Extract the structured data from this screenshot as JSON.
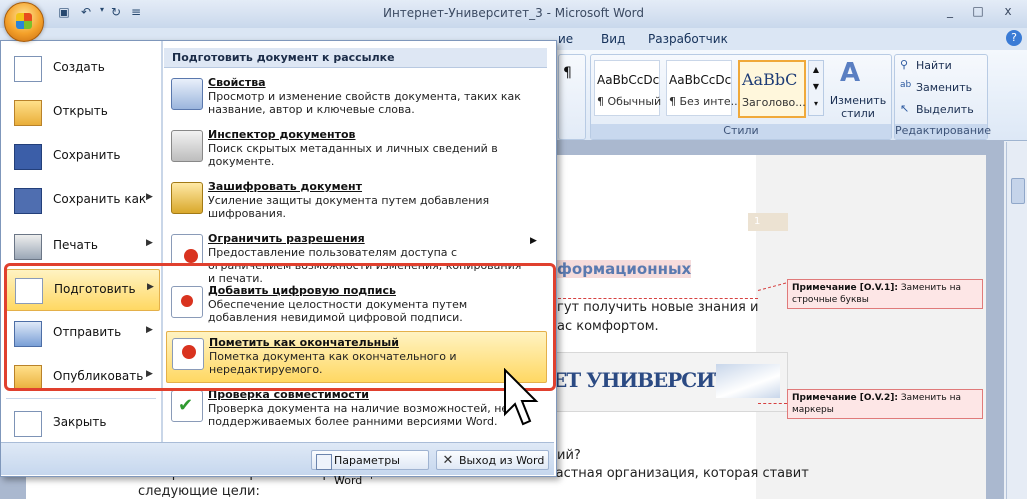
{
  "window": {
    "title": "Интернет-Университет_3 - Microsoft Word",
    "controls": [
      "_",
      "□",
      "x"
    ]
  },
  "ribbon": {
    "tabs": [
      "ие",
      "Вид",
      "Разработчик"
    ],
    "styles_group_label": "Стили",
    "editing_group_label": "Редактирование",
    "styles": [
      {
        "sample": "AaBbCcDc",
        "name": "¶ Обычный"
      },
      {
        "sample": "AaBbCcDc",
        "name": "¶ Без инте..."
      },
      {
        "sample": "AaBbC",
        "name": "Заголово..."
      }
    ],
    "change_styles": "Изменить стили",
    "find": "Найти",
    "replace": "Заменить",
    "select": "Выделить"
  },
  "menu": {
    "left_items": [
      {
        "label": "Создать",
        "arrow": ""
      },
      {
        "label": "Открыть",
        "arrow": ""
      },
      {
        "label": "Сохранить",
        "arrow": ""
      },
      {
        "label": "Сохранить как",
        "arrow": "▶"
      },
      {
        "label": "Печать",
        "arrow": "▶"
      },
      {
        "label": "Подготовить",
        "arrow": "▶"
      },
      {
        "label": "Отправить",
        "arrow": "▶"
      },
      {
        "label": "Опубликовать",
        "arrow": "▶"
      },
      {
        "label": "Закрыть",
        "arrow": ""
      }
    ],
    "submenu_header": "Подготовить документ к рассылке",
    "sub_items": [
      {
        "title": "Свойства",
        "desc": "Просмотр и изменение свойств документа, таких как название, автор и ключевые слова."
      },
      {
        "title": "Инспектор документов",
        "desc": "Поиск скрытых метаданных и личных сведений в документе."
      },
      {
        "title": "Зашифровать документ",
        "desc": "Усиление защиты документа путем добавления шифрования."
      },
      {
        "title": "Ограничить разрешения",
        "desc": "Предоставление пользователям доступа с ограничением возможности изменения, копирования и печати."
      },
      {
        "title": "Добавить цифровую подпись",
        "desc": "Обеспечение целостности документа путем добавления невидимой цифровой подписи."
      },
      {
        "title": "Пометить как окончательный",
        "desc": "Пометка документа как окончательного и нередактируемого."
      },
      {
        "title": "Проверка совместимости",
        "desc": "Проверка документа на наличие возможностей, не поддерживаемых более ранними версиями Word."
      }
    ],
    "options_button": "Параметры Word",
    "exit_button": "Выход из Word"
  },
  "document": {
    "heading_fragment": "формационных",
    "line1": "гут получить новые знания и",
    "line2": "ас комфортом.",
    "logo_text": "ЕТ УНИВЕРСИТЕТ",
    "line3": "ий?",
    "line4": "Интернет-Университет Информационных Технологий - это частная организация, которая ставит",
    "line5": "следующие цели:",
    "page_number_tag": "1",
    "comments": [
      {
        "label": "Примечание [O.V.1]:",
        "text": "Заменить на строчные буквы"
      },
      {
        "label": "Примечание [O.V.2]:",
        "text": "Заменить на маркеры"
      }
    ]
  }
}
